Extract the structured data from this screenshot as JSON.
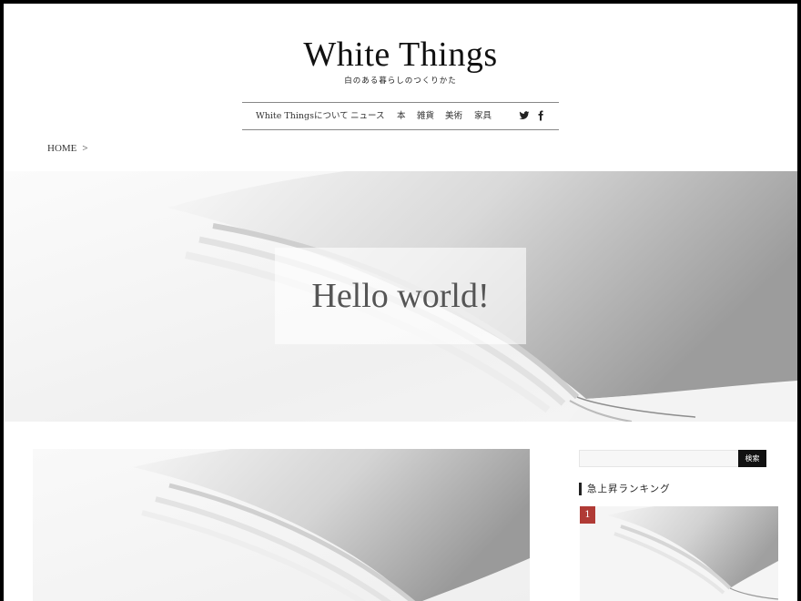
{
  "site": {
    "title": "White Things",
    "tagline": "白のある暮らしのつくりかた"
  },
  "nav": {
    "items": [
      {
        "label": "White Thingsについて"
      },
      {
        "label": "ニュース"
      },
      {
        "label": "本"
      },
      {
        "label": "雑貨"
      },
      {
        "label": "美術"
      },
      {
        "label": "家具"
      }
    ],
    "social_icons": [
      "twitter-icon",
      "facebook-icon"
    ]
  },
  "breadcrumb": {
    "home": "HOME",
    "separator": ">"
  },
  "hero": {
    "title": "Hello world!"
  },
  "sidebar": {
    "search": {
      "placeholder": "",
      "button_label": "検索"
    },
    "ranking": {
      "heading": "急上昇ランキング",
      "items": [
        {
          "rank": "1"
        }
      ]
    }
  },
  "colors": {
    "rank_badge": "#b03a35",
    "search_button": "#111111"
  }
}
